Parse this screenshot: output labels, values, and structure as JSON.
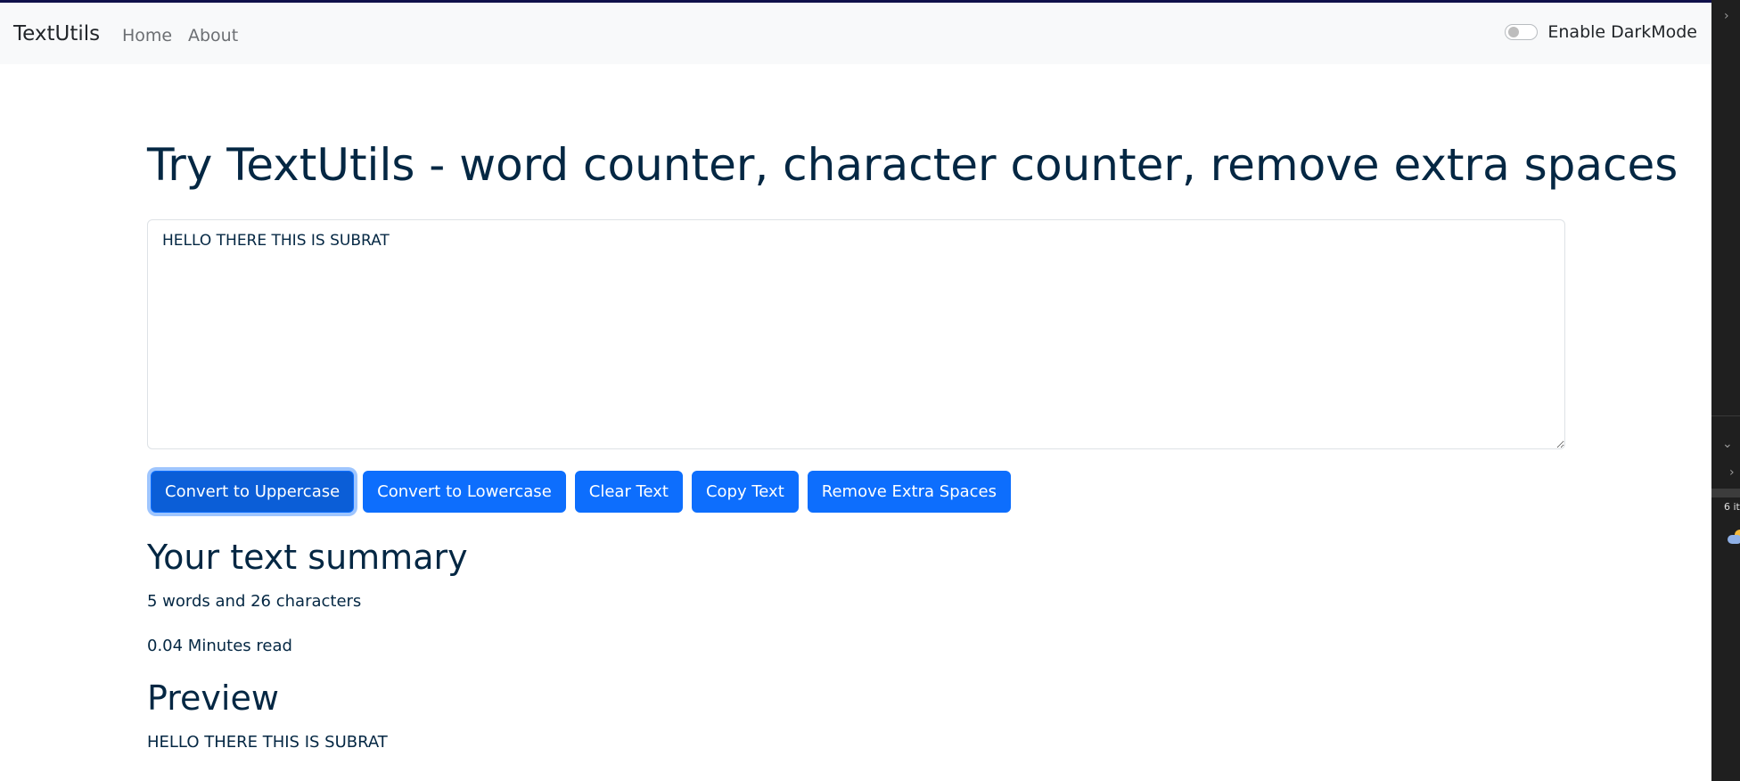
{
  "navbar": {
    "brand": "TextUtils",
    "links": [
      "Home",
      "About"
    ],
    "toggle_label": "Enable DarkMode",
    "toggle_on": false
  },
  "main": {
    "heading": "Try TextUtils - word counter, character counter, remove extra spaces",
    "textarea_value": "HELLO THERE THIS IS SUBRAT",
    "buttons": [
      "Convert to Uppercase",
      "Convert to Lowercase",
      "Clear Text",
      "Copy Text",
      "Remove Extra Spaces"
    ],
    "summary_heading": "Your text summary",
    "summary_counts": "5 words and 26 characters",
    "read_time": "0.04 Minutes read",
    "preview_heading": "Preview",
    "preview_text": "HELLO THERE THIS IS SUBRAT"
  },
  "side_panel": {
    "item_count_fragment": "6 it"
  },
  "colors": {
    "primary": "#0d6efd",
    "text": "#042743",
    "navbar_bg": "#f8f9fa"
  }
}
